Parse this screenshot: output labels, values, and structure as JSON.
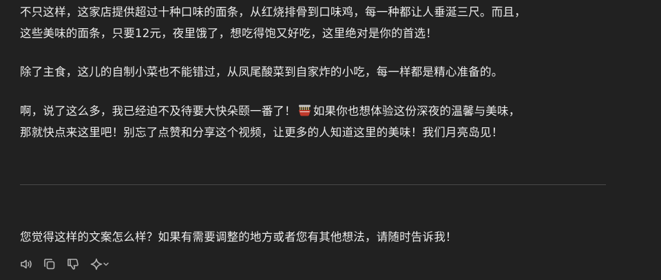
{
  "message": {
    "paragraph1": {
      "line1": "不只这样，这家店提供超过十种口味的面条，从红烧排骨到口味鸡，每一种都让人垂涎三尺。而且，",
      "line2": "这些美味的面条，只要12元，夜里饿了，想吃得饱又好吃，这里绝对是你的首选！"
    },
    "paragraph2": {
      "line1": "除了主食，这儿的自制小菜也不能错过，从凤尾酸菜到自家炸的小吃，每一样都是精心准备的。"
    },
    "paragraph3": {
      "line1_before_emoji": "啊，说了这么多，我已经迫不及待要大快朵颐一番了！",
      "line1_after_emoji": "如果你也想体验这份深夜的温馨与美味，",
      "line2": "那就快点来这里吧！别忘了点赞和分享这个视频，让更多的人知道这里的美味！我们月亮岛见！",
      "emoji_icon": "noodle-bowl-icon"
    },
    "question": "您觉得这样的文案怎么样？如果有需要调整的地方或者您有其他想法，请随时告诉我！"
  },
  "actions": {
    "icons": [
      "speaker-icon",
      "copy-icon",
      "thumbs-down-icon",
      "sparkle-icon",
      "chevron-down-icon"
    ]
  },
  "colors": {
    "background": "#212121",
    "text": "#ececec",
    "icon": "#b4b4b4",
    "divider": "#4a4a4a"
  }
}
